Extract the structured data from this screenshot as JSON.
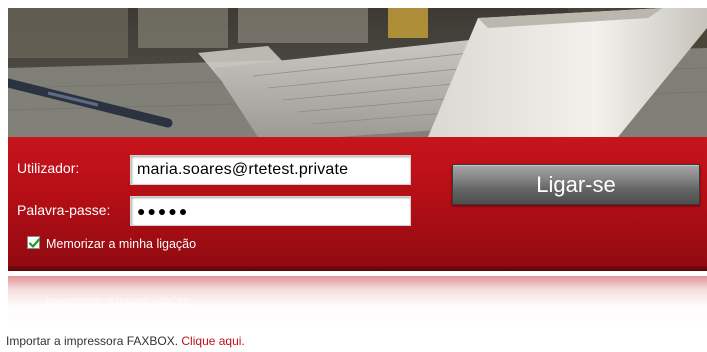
{
  "login": {
    "username_label": "Utilizador:",
    "username_value": "maria.soares@rtetest.private",
    "password_label": "Palavra-passe:",
    "password_value": "●●●●●",
    "submit_label": "Ligar-se",
    "remember_label": "Memorizar a minha ligação",
    "remember_checked": true
  },
  "footer": {
    "text": "Importar a impressora FAXBOX.",
    "link": "Clique aqui."
  },
  "colors": {
    "panel_red": "#b50e16",
    "link_red": "#c0101a",
    "button_gray": "#6a6a6a"
  }
}
